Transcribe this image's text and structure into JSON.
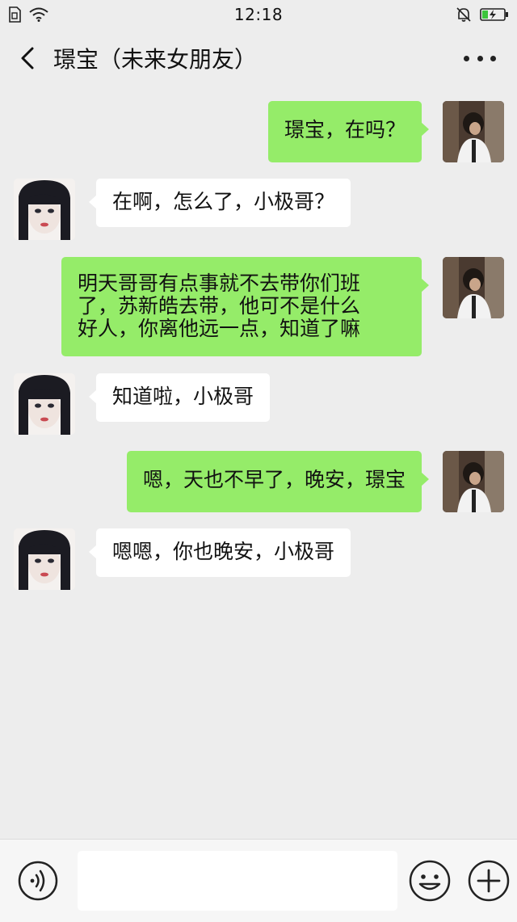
{
  "status_bar": {
    "time": "12:18"
  },
  "nav": {
    "title": "璟宝（未来女朋友）"
  },
  "messages": [
    {
      "side": "right",
      "text": "璟宝，在吗？"
    },
    {
      "side": "left",
      "text": "在啊，怎么了，小极哥？"
    },
    {
      "side": "right",
      "text": "明天哥哥有点事就不去带你们班\n了，苏新皓去带，他可不是什么\n好人，你离他远一点，知道了嘛"
    },
    {
      "side": "left",
      "text": "知道啦，小极哥"
    },
    {
      "side": "right",
      "text": "嗯，天也不早了，晚安，璟宝"
    },
    {
      "side": "left",
      "text": "嗯嗯，你也晚安，小极哥"
    }
  ],
  "input": {
    "value": ""
  },
  "colors": {
    "sent_bubble": "#95ec69",
    "received_bubble": "#ffffff",
    "background": "#ededed"
  },
  "icons": {
    "back": "chevron-left-icon",
    "more": "more-dots-icon",
    "voice": "voice-icon",
    "emoji": "emoji-icon",
    "plus": "plus-icon"
  }
}
